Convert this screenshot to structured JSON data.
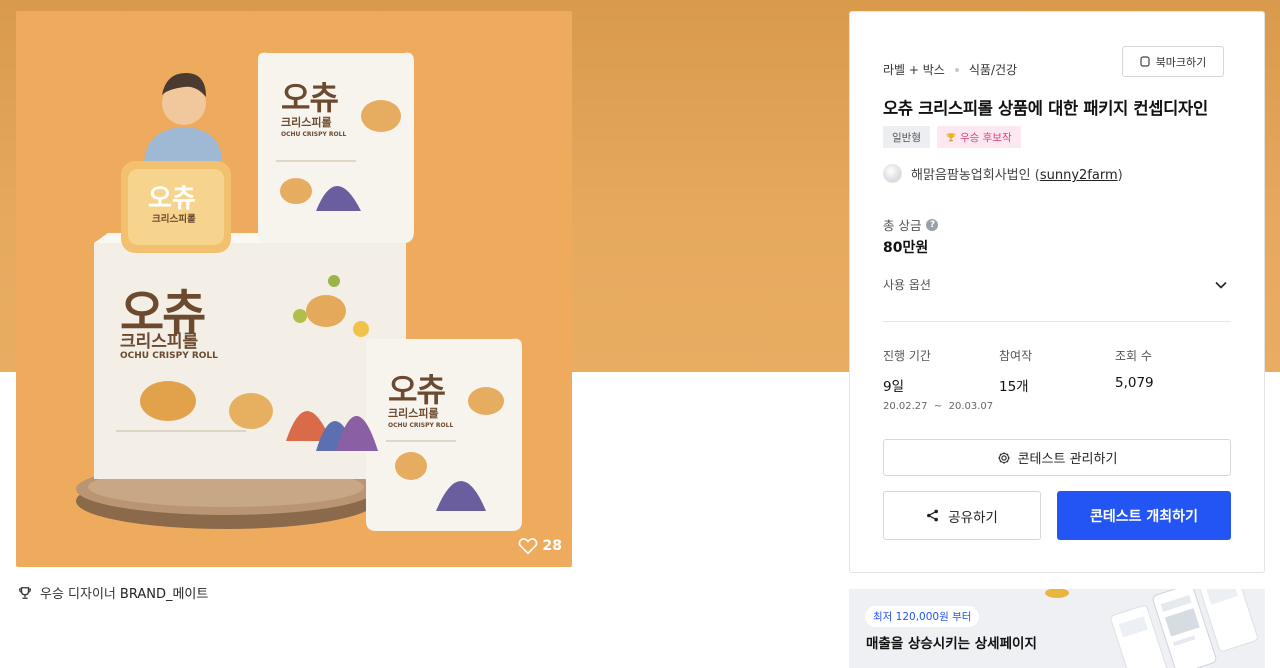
{
  "product": {
    "likes": "28",
    "package_text": {
      "brand_kr": "오츄",
      "name_kr": "크리스피롤",
      "name_en": "OCHU CRISPY ROLL"
    }
  },
  "winner": {
    "prefix": "우승 디자이너",
    "name": "BRAND_메이트"
  },
  "info": {
    "category": "라벨 + 박스",
    "subcategory": "식품/건강",
    "bookmark_label": "북마크하기",
    "title": "오츄 크리스피롤 상품에 대한 패키지 컨셉디자인",
    "badges": [
      "일반형",
      "우승 후보작"
    ],
    "author_name": "해맑음팜농업회사법인",
    "author_id": "sunny2farm",
    "prize_label": "총 상금",
    "prize_value": "80만원",
    "options_label": "사용 옵션",
    "stats": {
      "period_label": "진행 기간",
      "period_value": "9일",
      "period_range": "20.02.27  ~  20.03.07",
      "entries_label": "참여작",
      "entries_value": "15개",
      "views_label": "조회 수",
      "views_value": "5,079"
    },
    "manage_label": "콘테스트 관리하기",
    "share_label": "공유하기",
    "host_label": "콘테스트 개최하기"
  },
  "ad": {
    "tag": "최저 120,000원 부터",
    "title": "매출을 상승시키는 상세페이지"
  },
  "colors": {
    "accent": "#2355f5",
    "banner": "#e3a458",
    "pink_badge": "#e0407f"
  }
}
